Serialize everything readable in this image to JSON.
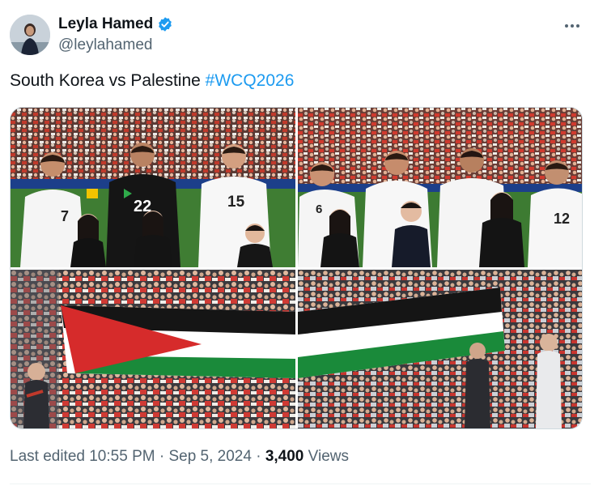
{
  "author": {
    "display_name": "Leyla Hamed",
    "handle": "@leylahamed",
    "verified": true,
    "avatar_icon": "profile-photo"
  },
  "tweet": {
    "text": "South Korea vs Palestine ",
    "hashtag": "#WCQ2026",
    "photos": [
      {
        "icon": "team-lineup-photo-left",
        "jersey_numbers": [
          "7",
          "22",
          "15"
        ]
      },
      {
        "icon": "team-lineup-photo-right",
        "jersey_numbers": [
          "6",
          "12"
        ]
      },
      {
        "icon": "palestine-flag-crowd-photo-left"
      },
      {
        "icon": "palestine-flag-crowd-photo-right"
      }
    ]
  },
  "meta": {
    "edited": "Last edited 10:55 PM · Sep 5, 2024 · ",
    "views_count": "3,400",
    "views_label": " Views"
  },
  "colors": {
    "link": "#1d9bf0",
    "secondary_text": "#536471",
    "verified": "#1d9bf0",
    "flag_red": "#d62b2b",
    "flag_green": "#1a8a3a",
    "flag_black": "#151515"
  }
}
